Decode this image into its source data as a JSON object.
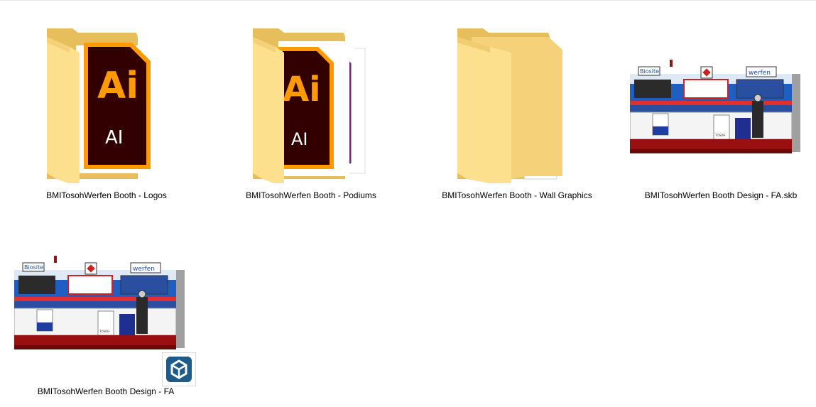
{
  "files": [
    {
      "name": "BMITosohWerfen Booth - Logos",
      "kind": "folder",
      "preview": "illustrator-doc-icon"
    },
    {
      "name": "BMITosohWerfen Booth - Podiums",
      "kind": "folder",
      "preview": "illustrator-doc-icon"
    },
    {
      "name": "BMITosohWerfen Booth - Wall Graphics",
      "kind": "folder",
      "preview": "document-page-icon"
    },
    {
      "name": "BMITosohWerfen Booth Design - FA.skb",
      "kind": "file",
      "preview": "booth-render-thumbnail"
    },
    {
      "name": "BMITosohWerfen Booth Design - FA",
      "kind": "file",
      "preview": "booth-render-thumbnail",
      "badge": "sketchup-icon"
    }
  ],
  "ai_icon": {
    "big": "Ai",
    "small": "AI"
  },
  "booth": {
    "brand1": "Biosite",
    "brand2": "werfen",
    "brand3": "TOSOH"
  },
  "colors": {
    "folder_light": "#FCE08E",
    "folder_dark": "#E7BE5C",
    "ai_bg": "#330000",
    "ai_accent": "#FF9A00",
    "sketchup_bg": "#1E5A8A"
  }
}
